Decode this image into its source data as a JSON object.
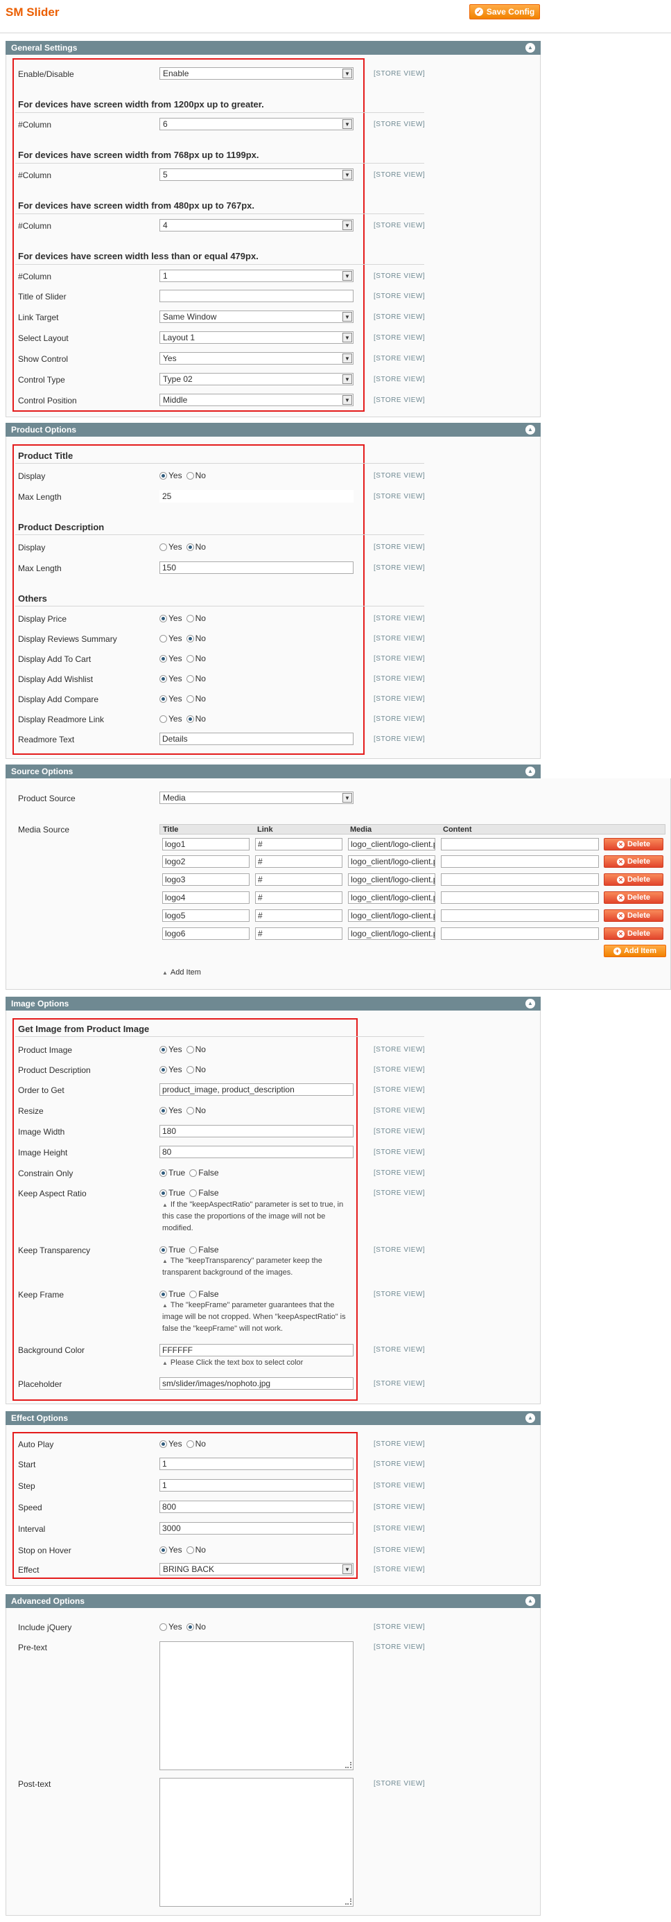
{
  "header": {
    "title": "SM Slider",
    "save_label": "Save Config"
  },
  "scope_label": "[STORE VIEW]",
  "general": {
    "title": "General Settings",
    "enable_label": "Enable/Disable",
    "enable_value": "Enable",
    "group1": "For devices have screen width from 1200px up to greater.",
    "group2": "For devices have screen width from 768px up to 1199px.",
    "group3": "For devices have screen width from 480px up to 767px.",
    "group4": "For devices have screen width less than or equal 479px.",
    "column_label": "#Column",
    "col1": "6",
    "col2": "5",
    "col3": "4",
    "col4": "1",
    "title_slider_label": "Title of Slider",
    "title_slider_value": "",
    "link_target_label": "Link Target",
    "link_target_value": "Same Window",
    "layout_label": "Select Layout",
    "layout_value": "Layout 1",
    "show_control_label": "Show Control",
    "show_control_value": "Yes",
    "control_type_label": "Control Type",
    "control_type_value": "Type 02",
    "control_position_label": "Control Position",
    "control_position_value": "Middle"
  },
  "product": {
    "title": "Product Options",
    "group_title": "Product Title",
    "display_label": "Display",
    "max_length_label": "Max Length",
    "title_max": "25",
    "group_desc": "Product Description",
    "desc_max": "150",
    "group_others": "Others",
    "display_price": "Display Price",
    "display_reviews": "Display Reviews Summary",
    "display_cart": "Display Add To Cart",
    "display_wishlist": "Display Add Wishlist",
    "display_compare": "Display Add Compare",
    "display_readmore": "Display Readmore Link",
    "readmore_text_label": "Readmore Text",
    "readmore_text_value": "Details"
  },
  "radio": {
    "yes": "Yes",
    "no": "No",
    "true": "True",
    "false": "False"
  },
  "source": {
    "title": "Source Options",
    "product_source_label": "Product Source",
    "product_source_value": "Media",
    "media_source_label": "Media Source",
    "columns": [
      "Title",
      "Link",
      "Media",
      "Content"
    ],
    "rows": [
      {
        "title": "logo1",
        "link": "#",
        "media": "logo_client/logo-client.p",
        "content": ""
      },
      {
        "title": "logo2",
        "link": "#",
        "media": "logo_client/logo-client.p",
        "content": ""
      },
      {
        "title": "logo3",
        "link": "#",
        "media": "logo_client/logo-client.p",
        "content": ""
      },
      {
        "title": "logo4",
        "link": "#",
        "media": "logo_client/logo-client.p",
        "content": ""
      },
      {
        "title": "logo5",
        "link": "#",
        "media": "logo_client/logo-client.p",
        "content": ""
      },
      {
        "title": "logo6",
        "link": "#",
        "media": "logo_client/logo-client.p",
        "content": ""
      }
    ],
    "delete_label": "Delete",
    "add_item_button": "Add Item",
    "add_item_link": "Add Item"
  },
  "image": {
    "title": "Image Options",
    "group": "Get Image from Product Image",
    "product_image": "Product Image",
    "product_desc": "Product Description",
    "order_label": "Order to Get",
    "order_value": "product_image, product_description",
    "resize": "Resize",
    "width_label": "Image Width",
    "width_value": "180",
    "height_label": "Image Height",
    "height_value": "80",
    "constrain": "Constrain Only",
    "aspect": "Keep Aspect Ratio",
    "aspect_note": "If the \"keepAspectRatio\" parameter is set to true, in this case the proportions of the image will not be modified.",
    "transparency": "Keep Transparency",
    "transparency_note": "The \"keepTransparency\" parameter keep the transparent background of the images.",
    "frame": "Keep Frame",
    "frame_note": "The \"keepFrame\" parameter guarantees that the image will be not cropped. When \"keepAspectRatio\" is false the \"keepFrame\" will not work.",
    "bg_label": "Background Color",
    "bg_value": "FFFFFF",
    "bg_note": "Please Click the text box to select color",
    "placeholder_label": "Placeholder",
    "placeholder_value": "sm/slider/images/nophoto.jpg"
  },
  "effect": {
    "title": "Effect Options",
    "autoplay": "Auto Play",
    "start_label": "Start",
    "start_value": "1",
    "step_label": "Step",
    "step_value": "1",
    "speed_label": "Speed",
    "speed_value": "800",
    "interval_label": "Interval",
    "interval_value": "3000",
    "stop_hover": "Stop on Hover",
    "effect_label": "Effect",
    "effect_value": "BRING BACK"
  },
  "advanced": {
    "title": "Advanced Options",
    "jquery": "Include jQuery",
    "pretext": "Pre-text",
    "posttext": "Post-text"
  },
  "colors": {
    "accent": "#eb5e00",
    "section_header": "#6f8992",
    "highlight_border": "#e41b1b"
  }
}
